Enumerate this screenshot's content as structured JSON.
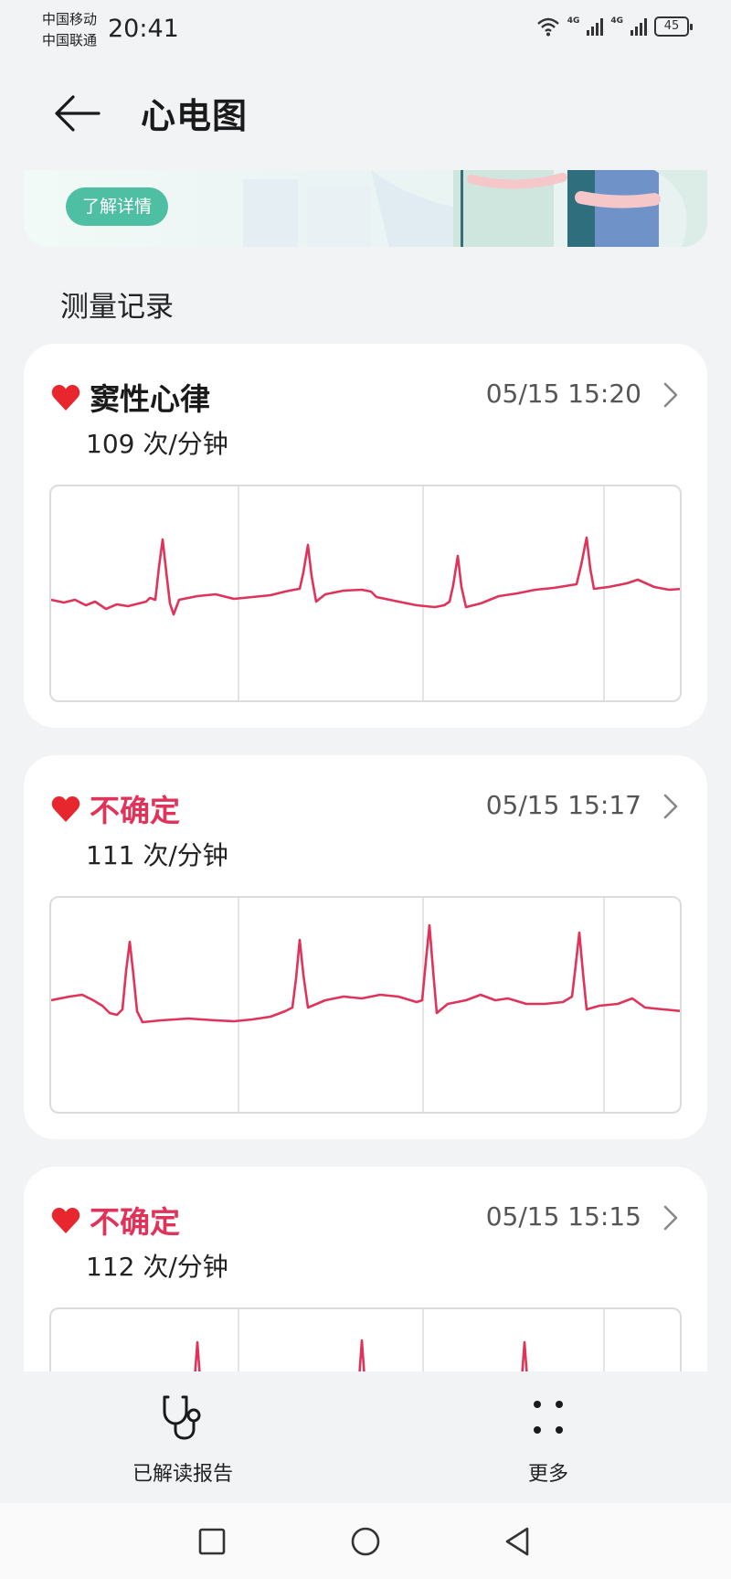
{
  "status_bar": {
    "carrier_1": "中国移动",
    "carrier_2": "中国联通",
    "time": "20:41",
    "battery": "45"
  },
  "header": {
    "title": "心电图",
    "back_icon": "arrow-left-icon"
  },
  "banner": {
    "button_label": "了解详情"
  },
  "records_section": {
    "title": "测量记录",
    "records": [
      {
        "status": "窦性心律",
        "time": "05/15 15:20",
        "rate": "109 次/分钟"
      },
      {
        "status": "不确定",
        "time": "05/15 15:17",
        "rate": "111 次/分钟"
      },
      {
        "status": "不确定",
        "time": "05/15 15:15",
        "rate": "112 次/分钟"
      }
    ]
  },
  "bottom_bar": {
    "reports_label": "已解读报告",
    "more_label": "更多"
  },
  "colors": {
    "ecg_line": "#e0335a",
    "heart": "#e8262e",
    "uncertain_text": "#e0335a",
    "accent": "#4fbfa4",
    "background": "#f1f3f5"
  },
  "icons": {
    "heart": "heart-icon",
    "chevron": "chevron-right-icon",
    "stethoscope": "stethoscope-icon",
    "more": "four-dots-icon",
    "nav": [
      "square-nav-icon",
      "circle-nav-icon",
      "triangle-back-nav-icon"
    ]
  }
}
